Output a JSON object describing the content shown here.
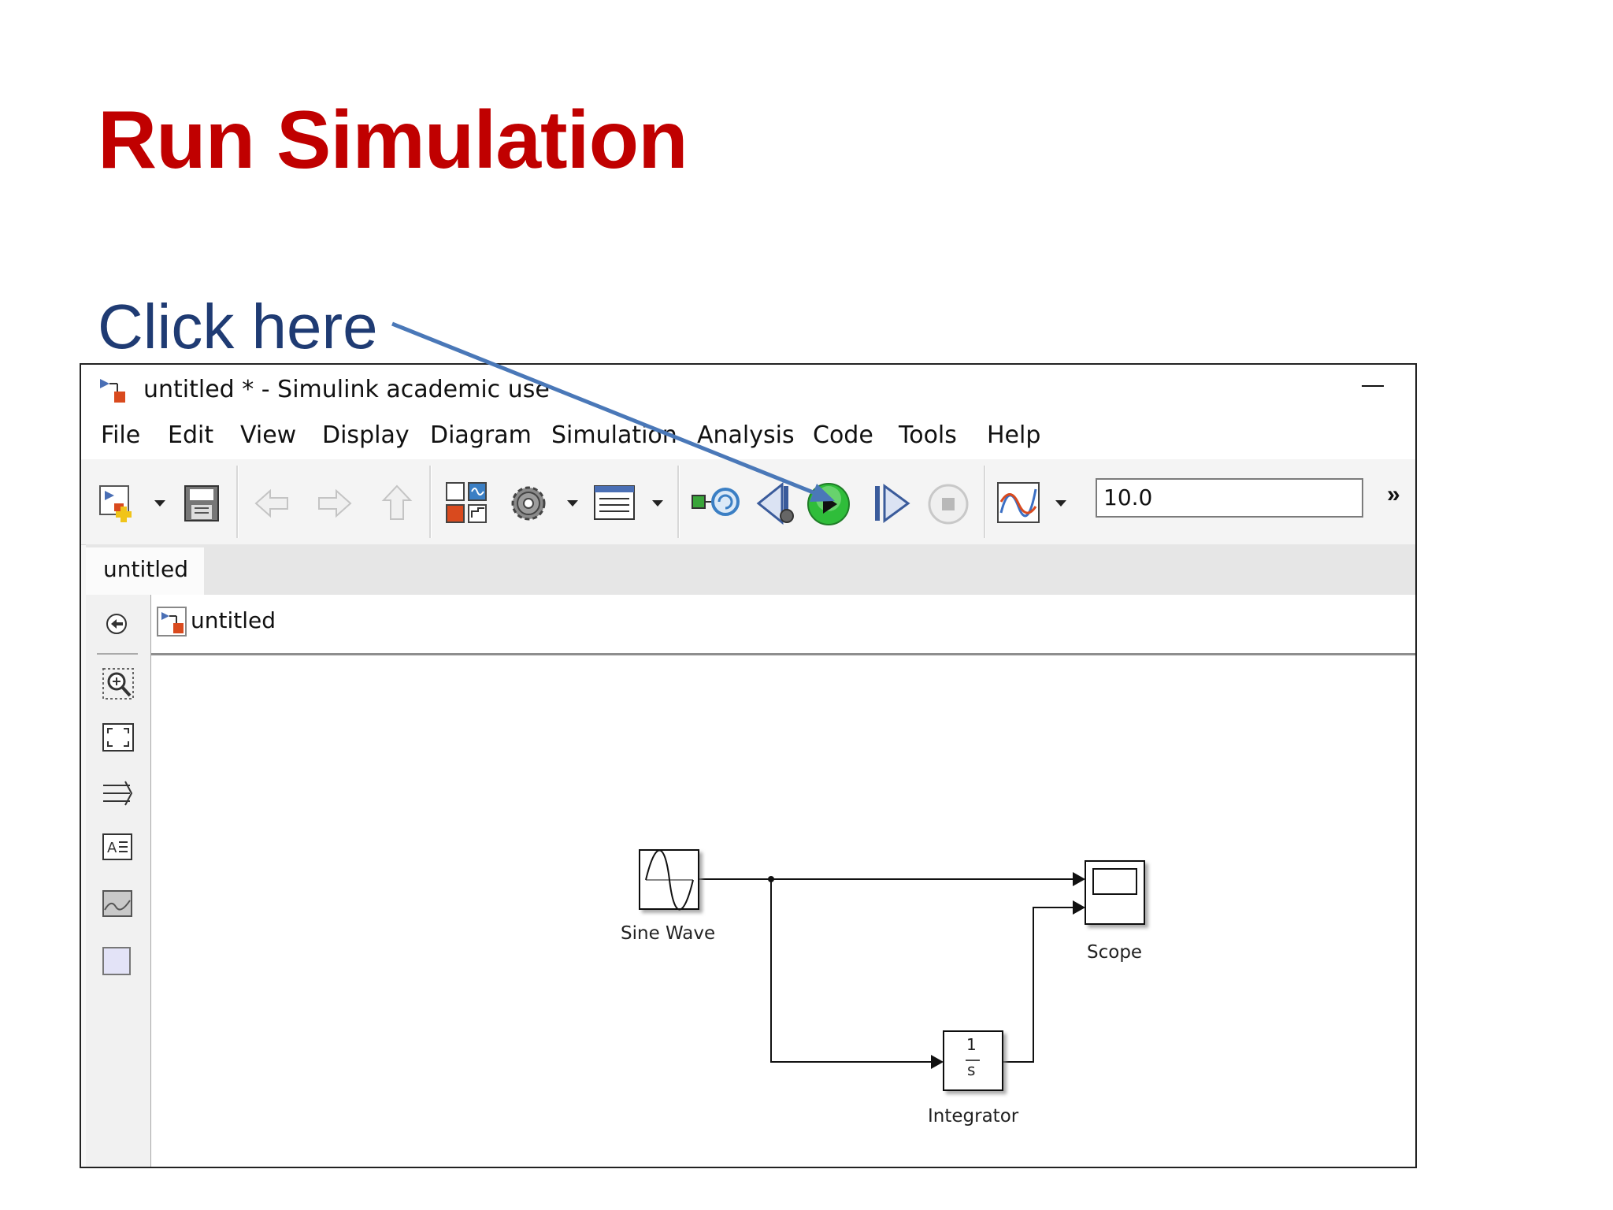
{
  "slide": {
    "title": "Run Simulation",
    "callout": "Click here"
  },
  "window": {
    "title": "untitled * - Simulink academic use",
    "minimize_glyph": "—"
  },
  "menu": [
    "File",
    "Edit",
    "View",
    "Display",
    "Diagram",
    "Simulation",
    "Analysis",
    "Code",
    "Tools",
    "Help"
  ],
  "toolbar": {
    "stop_time": "10.0",
    "overflow": "»",
    "icons": [
      "new-model-icon",
      "save-icon",
      "back-icon",
      "forward-icon",
      "up-icon",
      "library-browser-icon",
      "settings-gear-icon",
      "model-explorer-icon",
      "update-diagram-icon",
      "step-back-icon",
      "run-icon",
      "step-forward-icon",
      "stop-icon",
      "data-inspector-icon"
    ]
  },
  "tabs": [
    {
      "label": "untitled"
    }
  ],
  "address": {
    "label": "untitled"
  },
  "left_tools": [
    "back-icon",
    "zoom-in-icon",
    "fit-to-view-icon",
    "route-lines-icon",
    "annotation-icon",
    "image-icon",
    "area-icon"
  ],
  "blocks": {
    "sine": "Sine Wave",
    "scope": "Scope",
    "integrator": "Integrator",
    "integrator_num": "1",
    "integrator_den": "s"
  },
  "colors": {
    "title": "#c00000",
    "callout": "#1f3b73",
    "arrow": "#4a78b8",
    "run_button": "#2fbd3a"
  }
}
